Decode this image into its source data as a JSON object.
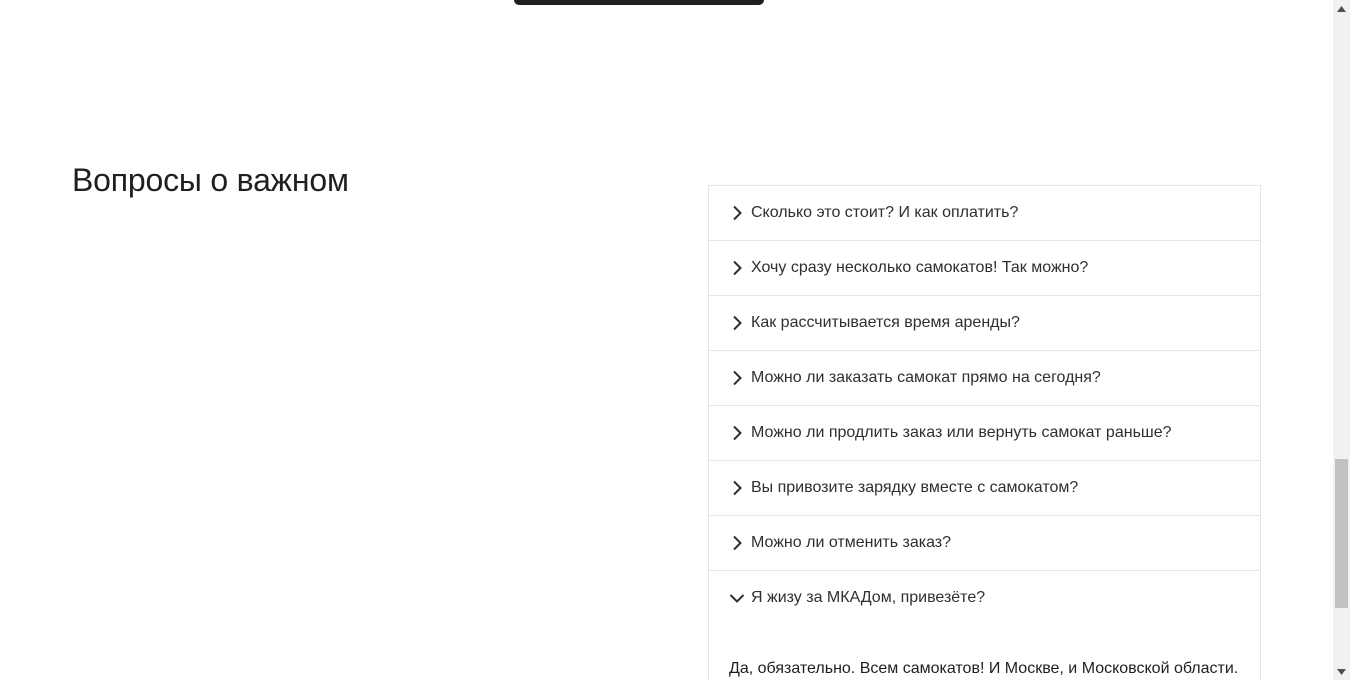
{
  "section": {
    "title": "Вопросы о важном"
  },
  "faq": {
    "items": [
      {
        "question": "Сколько это стоит? И как оплатить?",
        "expanded": false
      },
      {
        "question": "Хочу сразу несколько самокатов! Так можно?",
        "expanded": false
      },
      {
        "question": "Как рассчитывается время аренды?",
        "expanded": false
      },
      {
        "question": "Можно ли заказать самокат прямо на сегодня?",
        "expanded": false
      },
      {
        "question": "Можно ли продлить заказ или вернуть самокат раньше?",
        "expanded": false
      },
      {
        "question": "Вы привозите зарядку вместе с самокатом?",
        "expanded": false
      },
      {
        "question": "Можно ли отменить заказ?",
        "expanded": false
      },
      {
        "question": "Я жизу за МКАДом, привезёте?",
        "expanded": true,
        "answer": "Да, обязательно. Всем самокатов! И Москве, и Московской области."
      }
    ]
  },
  "icons": {
    "collapsed": "chevron-right-icon",
    "expanded": "chevron-down-icon"
  },
  "colors": {
    "border": "#e5e5e5",
    "text": "#2f2f2f",
    "scrollbar_track": "#f1f1f1",
    "scrollbar_thumb": "#c1c1c1"
  }
}
